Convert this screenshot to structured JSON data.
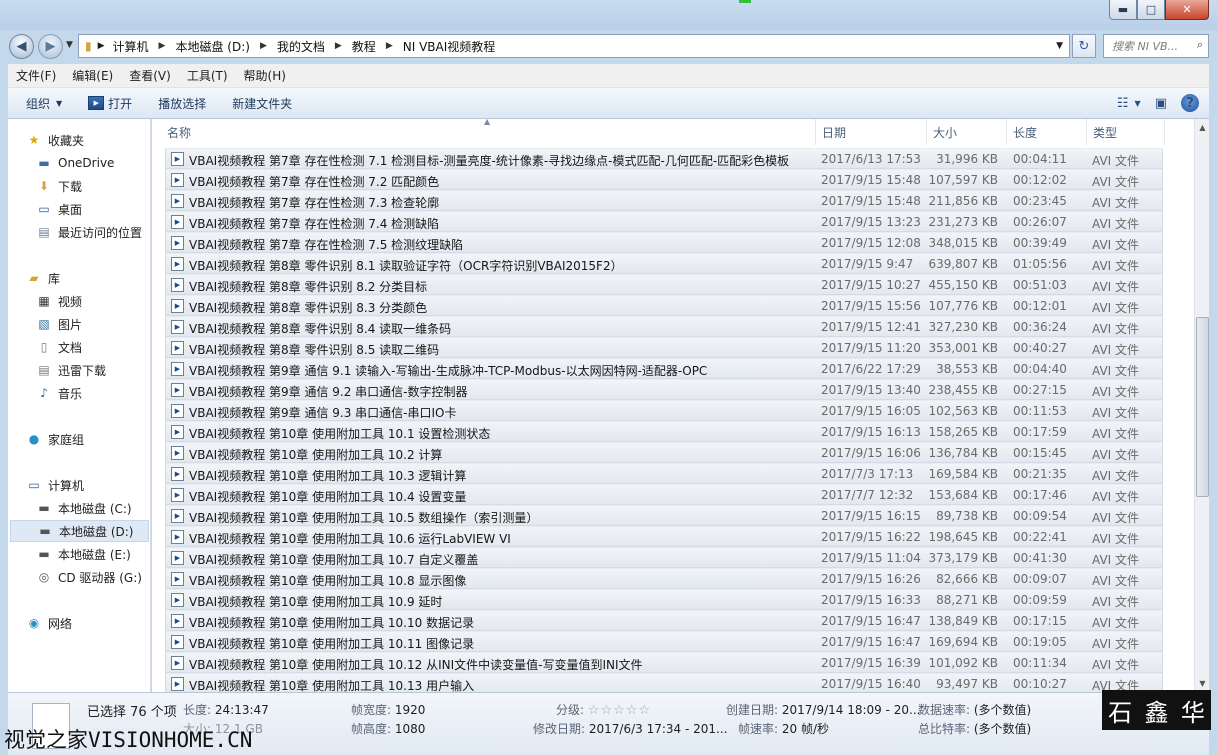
{
  "titlebar": {
    "caption_min": "▬",
    "caption_max": "□",
    "caption_close": "✕"
  },
  "address": {
    "crumbs": [
      "计算机",
      "本地磁盘 (D:)",
      "我的文档",
      "教程",
      "NI VBAI视频教程"
    ],
    "search_placeholder": "搜索 NI VB..."
  },
  "menu": [
    "文件(F)",
    "编辑(E)",
    "查看(V)",
    "工具(T)",
    "帮助(H)"
  ],
  "toolbar": {
    "organize": "组织",
    "open": "打开",
    "play": "播放选择",
    "new_folder": "新建文件夹"
  },
  "nav": {
    "favorites": "收藏夹",
    "favorites_items": [
      "OneDrive",
      "下载",
      "桌面",
      "最近访问的位置"
    ],
    "libraries": "库",
    "library_items": [
      "视频",
      "图片",
      "文档",
      "迅雷下载",
      "音乐"
    ],
    "homegroup": "家庭组",
    "computer": "计算机",
    "computer_items": [
      "本地磁盘 (C:)",
      "本地磁盘 (D:)",
      "本地磁盘 (E:)",
      "CD 驱动器 (G:)"
    ],
    "network": "网络"
  },
  "columns": {
    "name": "名称",
    "date": "日期",
    "size": "大小",
    "length": "长度",
    "type": "类型"
  },
  "files": [
    {
      "name": "VBAI视频教程 第7章 存在性检测 7.1 检测目标-测量亮度-统计像素-寻找边缘点-模式匹配-几何匹配-匹配彩色模板",
      "date": "2017/6/13 17:53",
      "size": "31,996 KB",
      "length": "00:04:11",
      "type": "AVI 文件"
    },
    {
      "name": "VBAI视频教程 第7章 存在性检测 7.2 匹配颜色",
      "date": "2017/9/15 15:48",
      "size": "107,597 KB",
      "length": "00:12:02",
      "type": "AVI 文件"
    },
    {
      "name": "VBAI视频教程 第7章 存在性检测 7.3 检查轮廓",
      "date": "2017/9/15 15:48",
      "size": "211,856 KB",
      "length": "00:23:45",
      "type": "AVI 文件"
    },
    {
      "name": "VBAI视频教程 第7章 存在性检测 7.4 检测缺陷",
      "date": "2017/9/15 13:23",
      "size": "231,273 KB",
      "length": "00:26:07",
      "type": "AVI 文件"
    },
    {
      "name": "VBAI视频教程 第7章 存在性检测 7.5 检测纹理缺陷",
      "date": "2017/9/15 12:08",
      "size": "348,015 KB",
      "length": "00:39:49",
      "type": "AVI 文件"
    },
    {
      "name": "VBAI视频教程 第8章 零件识别 8.1 读取验证字符（OCR字符识别VBAI2015F2）",
      "date": "2017/9/15 9:47",
      "size": "639,807 KB",
      "length": "01:05:56",
      "type": "AVI 文件"
    },
    {
      "name": "VBAI视频教程 第8章 零件识别 8.2 分类目标",
      "date": "2017/9/15 10:27",
      "size": "455,150 KB",
      "length": "00:51:03",
      "type": "AVI 文件"
    },
    {
      "name": "VBAI视频教程 第8章 零件识别 8.3 分类颜色",
      "date": "2017/9/15 15:56",
      "size": "107,776 KB",
      "length": "00:12:01",
      "type": "AVI 文件"
    },
    {
      "name": "VBAI视频教程 第8章 零件识别 8.4 读取一维条码",
      "date": "2017/9/15 12:41",
      "size": "327,230 KB",
      "length": "00:36:24",
      "type": "AVI 文件"
    },
    {
      "name": "VBAI视频教程 第8章 零件识别 8.5 读取二维码",
      "date": "2017/9/15 11:20",
      "size": "353,001 KB",
      "length": "00:40:27",
      "type": "AVI 文件"
    },
    {
      "name": "VBAI视频教程 第9章 通信 9.1 读输入-写输出-生成脉冲-TCP-Modbus-以太网因特网-适配器-OPC",
      "date": "2017/6/22 17:29",
      "size": "38,553 KB",
      "length": "00:04:40",
      "type": "AVI 文件"
    },
    {
      "name": "VBAI视频教程 第9章 通信 9.2 串口通信-数字控制器",
      "date": "2017/9/15 13:40",
      "size": "238,455 KB",
      "length": "00:27:15",
      "type": "AVI 文件"
    },
    {
      "name": "VBAI视频教程 第9章 通信 9.3 串口通信-串口IO卡",
      "date": "2017/9/15 16:05",
      "size": "102,563 KB",
      "length": "00:11:53",
      "type": "AVI 文件"
    },
    {
      "name": "VBAI视频教程 第10章 使用附加工具 10.1 设置检测状态",
      "date": "2017/9/15 16:13",
      "size": "158,265 KB",
      "length": "00:17:59",
      "type": "AVI 文件"
    },
    {
      "name": "VBAI视频教程 第10章 使用附加工具 10.2 计算",
      "date": "2017/9/15 16:06",
      "size": "136,784 KB",
      "length": "00:15:45",
      "type": "AVI 文件"
    },
    {
      "name": "VBAI视频教程 第10章 使用附加工具 10.3 逻辑计算",
      "date": "2017/7/3 17:13",
      "size": "169,584 KB",
      "length": "00:21:35",
      "type": "AVI 文件"
    },
    {
      "name": "VBAI视频教程 第10章 使用附加工具 10.4 设置变量",
      "date": "2017/7/7 12:32",
      "size": "153,684 KB",
      "length": "00:17:46",
      "type": "AVI 文件"
    },
    {
      "name": "VBAI视频教程 第10章 使用附加工具 10.5 数组操作（索引测量）",
      "date": "2017/9/15 16:15",
      "size": "89,738 KB",
      "length": "00:09:54",
      "type": "AVI 文件"
    },
    {
      "name": "VBAI视频教程 第10章 使用附加工具 10.6 运行LabVIEW VI",
      "date": "2017/9/15 16:22",
      "size": "198,645 KB",
      "length": "00:22:41",
      "type": "AVI 文件"
    },
    {
      "name": "VBAI视频教程 第10章 使用附加工具 10.7 自定义覆盖",
      "date": "2017/9/15 11:04",
      "size": "373,179 KB",
      "length": "00:41:30",
      "type": "AVI 文件"
    },
    {
      "name": "VBAI视频教程 第10章 使用附加工具 10.8 显示图像",
      "date": "2017/9/15 16:26",
      "size": "82,666 KB",
      "length": "00:09:07",
      "type": "AVI 文件"
    },
    {
      "name": "VBAI视频教程 第10章 使用附加工具 10.9 延时",
      "date": "2017/9/15 16:33",
      "size": "88,271 KB",
      "length": "00:09:59",
      "type": "AVI 文件"
    },
    {
      "name": "VBAI视频教程 第10章 使用附加工具 10.10 数据记录",
      "date": "2017/9/15 16:47",
      "size": "138,849 KB",
      "length": "00:17:15",
      "type": "AVI 文件"
    },
    {
      "name": "VBAI视频教程 第10章 使用附加工具 10.11 图像记录",
      "date": "2017/9/15 16:47",
      "size": "169,694 KB",
      "length": "00:19:05",
      "type": "AVI 文件"
    },
    {
      "name": "VBAI视频教程 第10章 使用附加工具 10.12 从INI文件中读变量值-写变量值到INI文件",
      "date": "2017/9/15 16:39",
      "size": "101,092 KB",
      "length": "00:11:34",
      "type": "AVI 文件"
    },
    {
      "name": "VBAI视频教程 第10章 使用附加工具 10.13 用户输入",
      "date": "2017/9/15 16:40",
      "size": "93,497 KB",
      "length": "00:10:27",
      "type": "AVI 文件"
    }
  ],
  "details": {
    "selected": "已选择 76 个项",
    "length_label": "长度:",
    "length_value": "24:13:47",
    "size_fragment": "大小: 12.1 GB",
    "frame_width_label": "帧宽度:",
    "frame_width_value": "1920",
    "frame_height_label": "帧高度:",
    "frame_height_value": "1080",
    "rating_label": "分级:",
    "rating_stars": "☆☆☆☆☆",
    "modified_label": "修改日期:",
    "modified_value": "2017/6/3 17:34 - 201...",
    "created_label": "创建日期:",
    "created_value": "2017/9/14 18:09 - 20...",
    "framerate_label": "帧速率:",
    "framerate_value": "20 帧/秒",
    "data_rate_label": "数据速率:",
    "data_rate_value": "(多个数值)",
    "total_bitrate_label": "总比特率:",
    "total_bitrate_value": "(多个数值)"
  },
  "overlay": {
    "watermark": "视觉之家VISIONHOME.CN",
    "logo": [
      "石",
      "鑫",
      "华"
    ]
  }
}
